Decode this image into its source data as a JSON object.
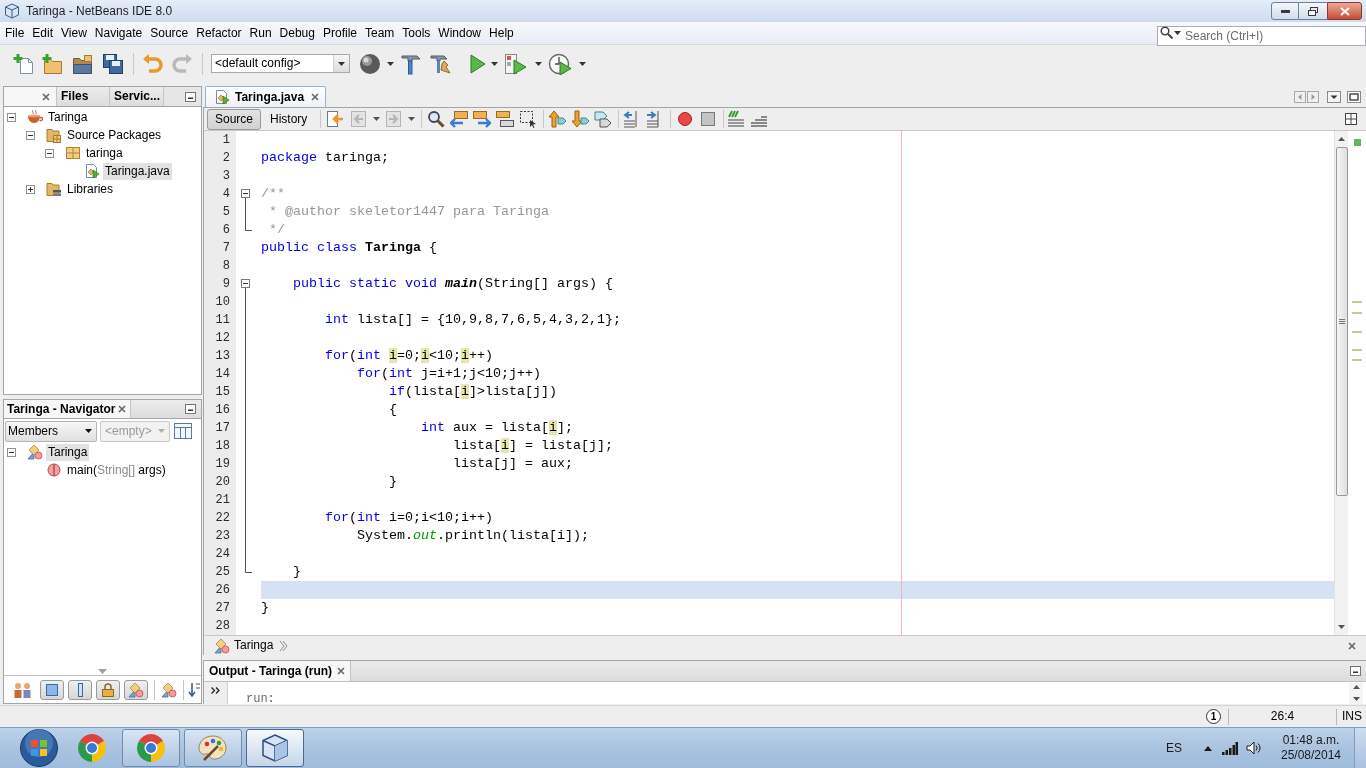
{
  "window": {
    "title": "Taringa - NetBeans IDE 8.0"
  },
  "menu": [
    "File",
    "Edit",
    "View",
    "Navigate",
    "Source",
    "Refactor",
    "Run",
    "Debug",
    "Profile",
    "Team",
    "Tools",
    "Window",
    "Help"
  ],
  "search": {
    "placeholder": "Search (Ctrl+I)"
  },
  "toolbar": {
    "undo": {
      "disabled": false
    },
    "redo": {
      "disabled": true
    },
    "config": "<default config>"
  },
  "projects": {
    "tabs": [
      {
        "selected": true
      },
      {
        "label": "Files",
        "selected": false
      },
      {
        "label": "Servic...",
        "selected": false
      }
    ],
    "tree": [
      {
        "label": "Taringa",
        "kind": "project",
        "expanded": true,
        "selected": false,
        "children": [
          {
            "label": "Source Packages",
            "kind": "source-folder",
            "expanded": true,
            "selected": false,
            "children": [
              {
                "label": "taringa",
                "kind": "package",
                "expanded": true,
                "selected": false,
                "children": [
                  {
                    "label": "Taringa.java",
                    "kind": "java-file",
                    "selected": true
                  }
                ]
              }
            ]
          },
          {
            "label": "Libraries",
            "kind": "library-folder",
            "expanded": false,
            "selected": false
          }
        ]
      }
    ]
  },
  "navigator": {
    "title": "Taringa - Navigator",
    "filter": "Members",
    "scope": {
      "value": "<empty>",
      "disabled": true
    },
    "tree": [
      {
        "parts": [
          {
            "text": "Taringa",
            "kind": "name"
          }
        ],
        "kind": "class",
        "expanded": true,
        "selected": true,
        "children": [
          {
            "parts": [
              {
                "text": "main(",
                "kind": "name"
              },
              {
                "text": "String[]",
                "kind": "type"
              },
              {
                "text": " args)",
                "kind": "name"
              }
            ],
            "kind": "method",
            "selected": false
          }
        ]
      }
    ]
  },
  "editor": {
    "tabs": [
      {
        "label": "Taringa.java",
        "selected": true
      }
    ],
    "views": [
      {
        "label": "Source",
        "selected": true
      },
      {
        "label": "History",
        "selected": false
      }
    ],
    "back": {
      "disabled": true
    },
    "forward": {
      "disabled": true
    },
    "lines": [
      {
        "number": "1",
        "current": false
      },
      {
        "number": "2",
        "current": false,
        "tokens": [
          {
            "kind": "keyword",
            "text": "package"
          },
          {
            "kind": "plain",
            "text": " taringa;"
          }
        ]
      },
      {
        "number": "3",
        "current": false
      },
      {
        "number": "4",
        "current": false,
        "fold": {
          "kind": "start"
        },
        "tokens": [
          {
            "kind": "comment",
            "text": "/**"
          }
        ]
      },
      {
        "number": "5",
        "current": false,
        "fold": {
          "kind": "middle"
        },
        "tokens": [
          {
            "kind": "comment",
            "text": " * @author skeletor1447 para Taringa"
          }
        ]
      },
      {
        "number": "6",
        "current": false,
        "fold": {
          "kind": "end"
        },
        "tokens": [
          {
            "kind": "comment",
            "text": " */"
          }
        ]
      },
      {
        "number": "7",
        "current": false,
        "tokens": [
          {
            "kind": "keyword",
            "text": "public class "
          },
          {
            "kind": "bold",
            "text": "Taringa"
          },
          {
            "kind": "plain",
            "text": " {"
          }
        ]
      },
      {
        "number": "8",
        "current": false
      },
      {
        "number": "9",
        "current": false,
        "fold": {
          "kind": "start"
        },
        "tokens": [
          {
            "kind": "keyword",
            "text": "    public static void "
          },
          {
            "kind": "method",
            "text": "main"
          },
          {
            "kind": "plain",
            "text": "(String[] args) {"
          }
        ]
      },
      {
        "number": "10",
        "current": false,
        "fold": {
          "kind": "middle"
        }
      },
      {
        "number": "11",
        "current": false,
        "fold": {
          "kind": "middle"
        },
        "tokens": [
          {
            "kind": "keyword",
            "text": "        int"
          },
          {
            "kind": "plain",
            "text": " lista[] = {10,9,8,7,6,5,4,3,2,1};"
          }
        ]
      },
      {
        "number": "12",
        "current": false,
        "fold": {
          "kind": "middle"
        }
      },
      {
        "number": "13",
        "current": false,
        "fold": {
          "kind": "middle"
        },
        "tokens": [
          {
            "kind": "keyword",
            "text": "        for"
          },
          {
            "kind": "plain",
            "text": "("
          },
          {
            "kind": "keyword",
            "text": "int "
          },
          {
            "kind": "mark",
            "text": "i"
          },
          {
            "kind": "plain",
            "text": "=0;"
          },
          {
            "kind": "mark",
            "text": "i"
          },
          {
            "kind": "plain",
            "text": "<10;"
          },
          {
            "kind": "mark",
            "text": "i"
          },
          {
            "kind": "plain",
            "text": "++)"
          }
        ]
      },
      {
        "number": "14",
        "current": false,
        "fold": {
          "kind": "middle"
        },
        "tokens": [
          {
            "kind": "keyword",
            "text": "            for"
          },
          {
            "kind": "plain",
            "text": "("
          },
          {
            "kind": "keyword",
            "text": "int"
          },
          {
            "kind": "plain",
            "text": " j=i+1;j<10;j++)"
          }
        ]
      },
      {
        "number": "15",
        "current": false,
        "fold": {
          "kind": "middle"
        },
        "tokens": [
          {
            "kind": "keyword",
            "text": "                if"
          },
          {
            "kind": "plain",
            "text": "(lista["
          },
          {
            "kind": "mark",
            "text": "i"
          },
          {
            "kind": "plain",
            "text": "]>lista[j])"
          }
        ]
      },
      {
        "number": "16",
        "current": false,
        "fold": {
          "kind": "middle"
        },
        "tokens": [
          {
            "kind": "plain",
            "text": "                {"
          }
        ]
      },
      {
        "number": "17",
        "current": false,
        "fold": {
          "kind": "middle"
        },
        "tokens": [
          {
            "kind": "keyword",
            "text": "                    int"
          },
          {
            "kind": "plain",
            "text": " aux = lista["
          },
          {
            "kind": "mark",
            "text": "i"
          },
          {
            "kind": "plain",
            "text": "];"
          }
        ]
      },
      {
        "number": "18",
        "current": false,
        "fold": {
          "kind": "middle"
        },
        "tokens": [
          {
            "kind": "plain",
            "text": "                        lista["
          },
          {
            "kind": "mark",
            "text": "i"
          },
          {
            "kind": "plain",
            "text": "] = lista[j];"
          }
        ]
      },
      {
        "number": "19",
        "current": false,
        "fold": {
          "kind": "middle"
        },
        "tokens": [
          {
            "kind": "plain",
            "text": "                        lista[j] = aux;"
          }
        ]
      },
      {
        "number": "20",
        "current": false,
        "fold": {
          "kind": "middle"
        },
        "tokens": [
          {
            "kind": "plain",
            "text": "                }"
          }
        ]
      },
      {
        "number": "21",
        "current": false,
        "fold": {
          "kind": "middle"
        }
      },
      {
        "number": "22",
        "current": false,
        "fold": {
          "kind": "middle"
        },
        "tokens": [
          {
            "kind": "keyword",
            "text": "        for"
          },
          {
            "kind": "plain",
            "text": "("
          },
          {
            "kind": "keyword",
            "text": "int"
          },
          {
            "kind": "plain",
            "text": " i=0;i<10;i++)"
          }
        ]
      },
      {
        "number": "23",
        "current": false,
        "fold": {
          "kind": "middle"
        },
        "tokens": [
          {
            "kind": "plain",
            "text": "            System."
          },
          {
            "kind": "field",
            "text": "out"
          },
          {
            "kind": "plain",
            "text": ".println(lista[i]);"
          }
        ]
      },
      {
        "number": "24",
        "current": false,
        "fold": {
          "kind": "middle"
        }
      },
      {
        "number": "25",
        "current": false,
        "fold": {
          "kind": "end"
        },
        "tokens": [
          {
            "kind": "plain",
            "text": "    }"
          }
        ]
      },
      {
        "number": "26",
        "current": true
      },
      {
        "number": "27",
        "current": false,
        "tokens": [
          {
            "kind": "plain",
            "text": "}"
          }
        ]
      },
      {
        "number": "28",
        "current": false
      }
    ],
    "breadcrumb": [
      "Taringa"
    ]
  },
  "output": {
    "title": "Output - Taringa (run)",
    "lines": [
      "run:"
    ]
  },
  "status_bar": {
    "notifications": "1",
    "caret": "26:4",
    "mode": "INS"
  },
  "taskbar": {
    "apps": [
      {
        "kind": "chrome",
        "running": false,
        "selected": false
      },
      {
        "kind": "chrome",
        "running": true,
        "selected": false
      },
      {
        "kind": "paint",
        "running": true,
        "selected": false
      },
      {
        "kind": "netbeans",
        "running": true,
        "selected": true
      }
    ],
    "language": "ES",
    "time": "01:48 a.m.",
    "date": "25/08/2014"
  }
}
